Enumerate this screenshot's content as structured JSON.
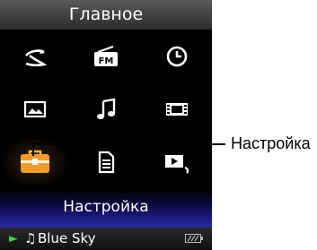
{
  "header": {
    "title": "Главное"
  },
  "menu": {
    "items": [
      {
        "name": "repeat-arrow-icon",
        "label": ""
      },
      {
        "name": "fm-radio-icon",
        "label": "FM"
      },
      {
        "name": "clock-icon",
        "label": ""
      },
      {
        "name": "picture-icon",
        "label": ""
      },
      {
        "name": "music-note-icon",
        "label": ""
      },
      {
        "name": "film-icon",
        "label": ""
      },
      {
        "name": "toolbox-icon",
        "label": ""
      },
      {
        "name": "document-icon",
        "label": ""
      },
      {
        "name": "output-arrow-icon",
        "label": ""
      }
    ],
    "selected_label": "Настройка",
    "accent": "#f29b2b"
  },
  "status": {
    "play_symbol": "►",
    "note_symbol": "♫",
    "track": "Blue Sky"
  },
  "callout": {
    "label": "Настройка"
  }
}
